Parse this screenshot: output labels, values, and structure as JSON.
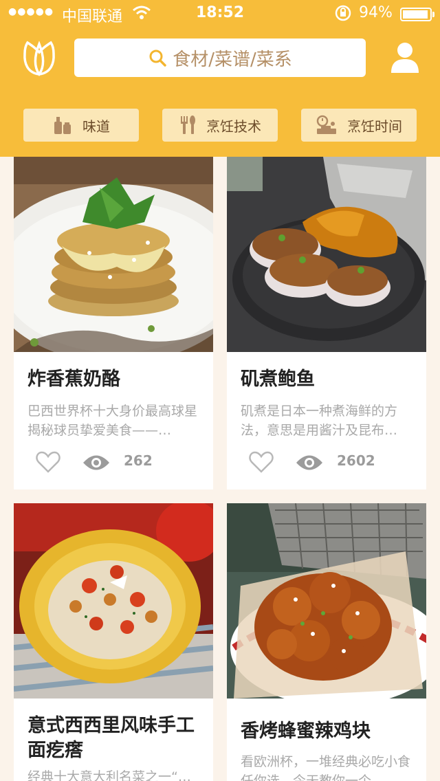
{
  "status_bar": {
    "carrier": "中国联通",
    "time": "18:52",
    "battery": "94%"
  },
  "search": {
    "placeholder": "食材/菜谱/菜系"
  },
  "filters": [
    {
      "label": "味道",
      "icon": "seasoning-bottles-icon"
    },
    {
      "label": "烹饪技术",
      "icon": "utensils-icon"
    },
    {
      "label": "烹饪时间",
      "icon": "timer-scale-icon"
    }
  ],
  "recipes": [
    {
      "title": "炸香蕉奶酪",
      "desc": "巴西世界杯十大身价最高球星揭秘球员挚爱美食——…",
      "views": "262"
    },
    {
      "title": "矶煮鲍鱼",
      "desc": "矶煮是日本一种煮海鲜的方法，意思是用酱汁及昆布…",
      "views": "2602"
    },
    {
      "title": "意式西西里风味手工面疙瘩",
      "desc": "经典十大意大利名菜之一“…",
      "views": ""
    },
    {
      "title": "香烤蜂蜜辣鸡块",
      "desc": "看欧洲杯，一堆经典必吃小食任你选，今天教你一个…",
      "views": ""
    }
  ],
  "colors": {
    "header": "#f7bd3a",
    "filter_bg": "#fbe7b7",
    "page_bg": "#fbf3ea"
  }
}
